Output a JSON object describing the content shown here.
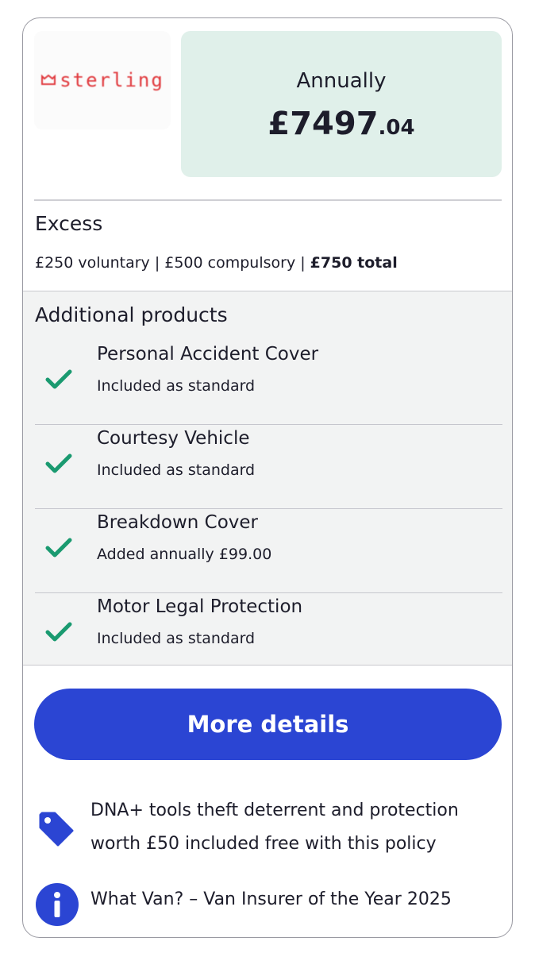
{
  "header": {
    "logo_text": "sterling",
    "period": "Annually",
    "price_main": "£7497",
    "price_pence": ".04"
  },
  "excess": {
    "title": "Excess",
    "voluntary": "£250 voluntary | £500 compulsory | ",
    "total": "£750 total"
  },
  "additional": {
    "title": "Additional products",
    "items": [
      {
        "name": "Personal Accident Cover",
        "status": "Included as standard"
      },
      {
        "name": "Courtesy Vehicle",
        "status": "Included as standard"
      },
      {
        "name": "Breakdown Cover",
        "status": "Added annually £99.00"
      },
      {
        "name": "Motor Legal Protection",
        "status": "Included as standard"
      }
    ]
  },
  "actions": {
    "more_details_label": "More details"
  },
  "notes": {
    "dna": "DNA+ tools theft deterrent and protection worth £50 included free with this policy",
    "award": "What Van? – Van Insurer of the Year 2025"
  },
  "colors": {
    "accent": "#2b45d3",
    "check": "#1a9a70",
    "price_bg": "#e0f0ea",
    "logo": "#e03a3e"
  }
}
